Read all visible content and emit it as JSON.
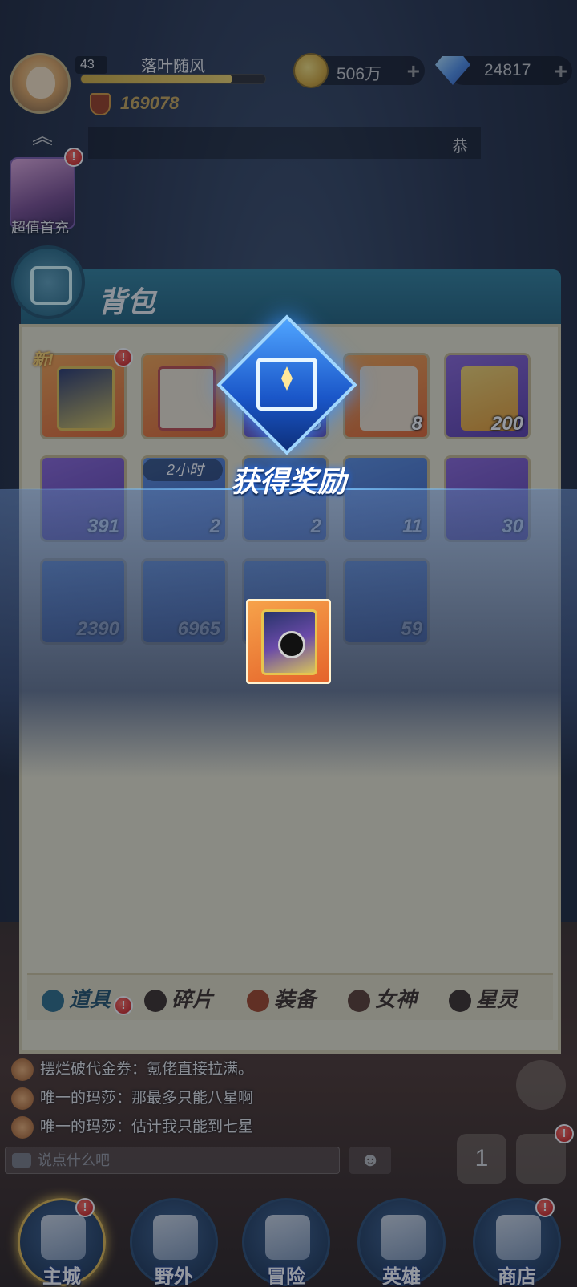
{
  "hud": {
    "level": "43",
    "player_name": "落叶随风",
    "xp_fraction": 0.82,
    "power": "169078",
    "gold": "506万",
    "gems": "24817",
    "plus": "+",
    "marquee_text": "恭",
    "collapse_arrow": "︽",
    "promo_label": "超值首充"
  },
  "badges": {
    "alert": "!"
  },
  "backpack": {
    "title": "背包",
    "new_tag": "新!",
    "timer_tag": "2小时",
    "slots": [
      {
        "count": ""
      },
      {
        "count": ""
      },
      {
        "count": "5"
      },
      {
        "count": "8"
      },
      {
        "count": "200"
      },
      {
        "count": "391"
      },
      {
        "count": "2"
      },
      {
        "count": "2"
      },
      {
        "count": "11"
      },
      {
        "count": "30"
      },
      {
        "count": "2390"
      },
      {
        "count": "6965"
      },
      {
        "count": ""
      },
      {
        "count": "59"
      }
    ],
    "tabs": [
      {
        "label": "道具"
      },
      {
        "label": "碎片"
      },
      {
        "label": "装备"
      },
      {
        "label": "女神"
      },
      {
        "label": "星灵"
      }
    ]
  },
  "reward": {
    "title": "获得奖励"
  },
  "chat": {
    "lines": [
      "摆烂破代金券：氪佬直接拉满。",
      "唯一的玛莎：那最多只能八星啊",
      "唯一的玛莎：估计我只能到七星"
    ],
    "input_placeholder": "说点什么吧",
    "emoji_glyph": "☻"
  },
  "side": {
    "rank_glyph": "1"
  },
  "nav": [
    {
      "label": "主城"
    },
    {
      "label": "野外"
    },
    {
      "label": "冒险"
    },
    {
      "label": "英雄"
    },
    {
      "label": "商店"
    }
  ]
}
